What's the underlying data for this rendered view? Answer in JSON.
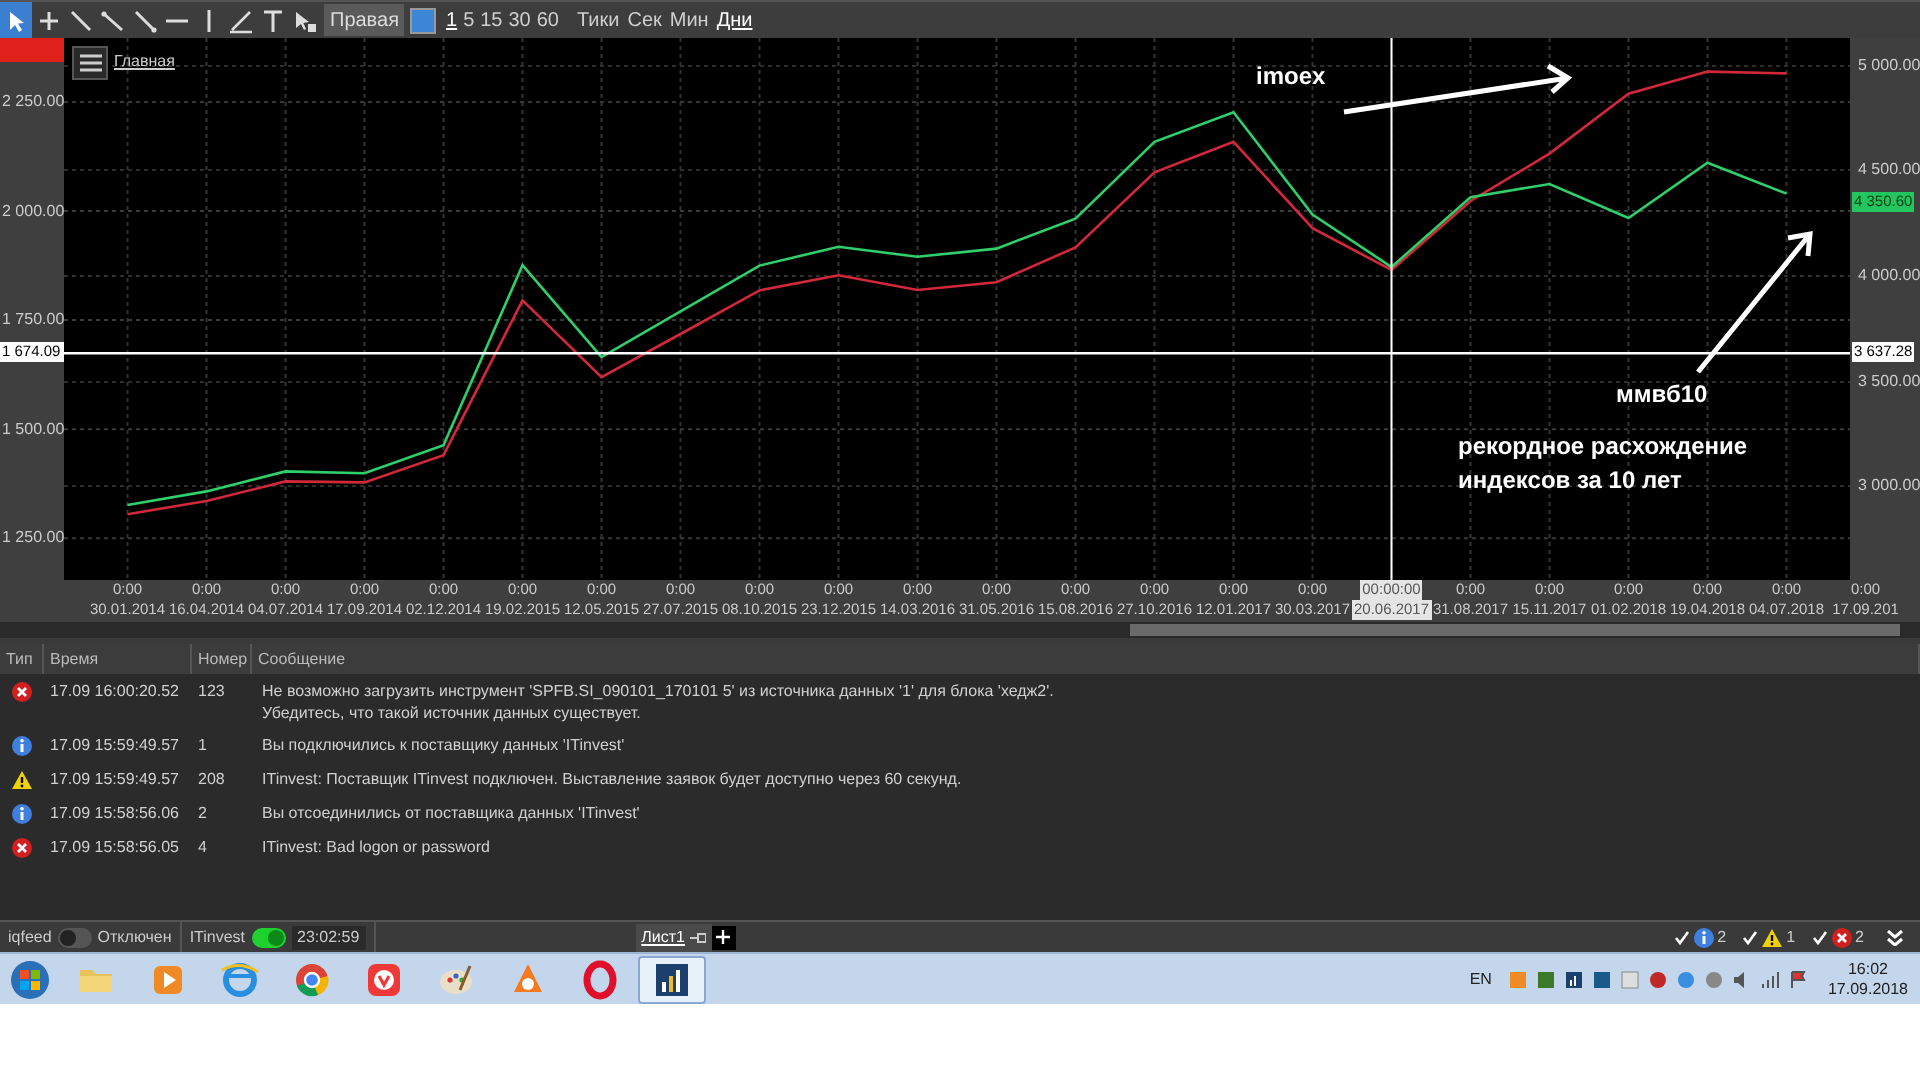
{
  "toolbar": {
    "tools": [
      {
        "kind": "pointer",
        "selected": true
      },
      {
        "kind": "crosshair",
        "selected": false
      },
      {
        "kind": "line",
        "selected": false
      },
      {
        "kind": "ray",
        "selected": false
      },
      {
        "kind": "segment",
        "selected": false
      },
      {
        "kind": "hline",
        "selected": false
      },
      {
        "kind": "vline",
        "selected": false
      },
      {
        "kind": "channel",
        "selected": false
      },
      {
        "kind": "text",
        "selected": false
      },
      {
        "kind": "cursor",
        "selected": false
      }
    ],
    "axis_dropdown": "Правая",
    "intervals": [
      {
        "label": "1",
        "selected": true
      },
      {
        "label": "5",
        "selected": false
      },
      {
        "label": "15",
        "selected": false
      },
      {
        "label": "30",
        "selected": false
      },
      {
        "label": "60",
        "selected": false
      }
    ],
    "units": [
      {
        "label": "Тики",
        "selected": false
      },
      {
        "label": "Сек",
        "selected": false
      },
      {
        "label": "Мин",
        "selected": false
      },
      {
        "label": "Дни",
        "selected": true
      }
    ]
  },
  "chart": {
    "panel_label": "Главная",
    "left_axis": {
      "current": "1 674.09"
    },
    "right_axis": {
      "ticks": [
        "5 000.00",
        "4 500.00",
        "4 000.00",
        "3 500.00",
        "3 000.00"
      ],
      "last": "4 350.60",
      "current": "3 637.28"
    },
    "time_axis": [
      {
        "time": "0:00",
        "selected": false
      },
      {
        "time": "0:00",
        "selected": false
      },
      {
        "time": "0:00",
        "selected": false
      },
      {
        "time": "0:00",
        "selected": false
      },
      {
        "time": "0:00",
        "selected": false
      },
      {
        "time": "0:00",
        "selected": false
      },
      {
        "time": "0:00",
        "selected": false
      },
      {
        "time": "0:00",
        "selected": false
      },
      {
        "time": "0:00",
        "selected": false
      },
      {
        "time": "0:00",
        "selected": false
      },
      {
        "time": "0:00",
        "selected": false
      },
      {
        "time": "0:00",
        "selected": false
      },
      {
        "time": "0:00",
        "selected": false
      },
      {
        "time": "0:00",
        "selected": false
      },
      {
        "time": "0:00",
        "selected": false
      },
      {
        "time": "0:00",
        "selected": false
      },
      {
        "time": "00:00:00",
        "selected": true
      },
      {
        "time": "0:00",
        "selected": false
      },
      {
        "time": "0:00",
        "selected": false
      },
      {
        "time": "0:00",
        "selected": false
      },
      {
        "time": "0:00",
        "selected": false
      },
      {
        "time": "0:00",
        "selected": false
      },
      {
        "time": "0:00",
        "selected": false
      }
    ],
    "chart_data": {
      "type": "line",
      "categories": [
        "30.01.2014",
        "16.04.2014",
        "04.07.2014",
        "17.09.2014",
        "02.12.2014",
        "19.02.2015",
        "12.05.2015",
        "27.07.2015",
        "08.10.2015",
        "23.12.2015",
        "14.03.2016",
        "31.05.2016",
        "15.08.2016",
        "27.10.2016",
        "12.01.2017",
        "30.03.2017",
        "20.06.2017",
        "31.08.2017",
        "15.11.2017",
        "01.02.2018",
        "19.04.2018",
        "04.07.2018",
        "17.09.201"
      ],
      "ylim": [
        1154,
        2397
      ],
      "grid": true,
      "ref_lines": [
        {
          "axis": "x",
          "value": "20.06.2017"
        },
        {
          "axis": "y",
          "value": 1674.09
        }
      ],
      "yticks": [
        {
          "value": 2250,
          "label": "2 250.00"
        },
        {
          "value": 2000,
          "label": "2 000.00"
        },
        {
          "value": 1750,
          "label": "1 750.00"
        },
        {
          "value": 1500,
          "label": "1 500.00"
        },
        {
          "value": 1250,
          "label": "1 250.00"
        }
      ],
      "series": [
        {
          "color": "#d2283a",
          "values": [
            1305,
            1335,
            1380,
            1378,
            1440,
            1795,
            1619,
            1718,
            1818,
            1853,
            1819,
            1837,
            1917,
            2089,
            2159,
            1961,
            1865,
            2023,
            2132,
            2269,
            2320,
            2316,
            null
          ]
        },
        {
          "color": "#2fcf6a",
          "values": [
            1326,
            1357,
            1403,
            1399,
            1463,
            1876,
            1665,
            1770,
            1875,
            1918,
            1895,
            1914,
            1983,
            2159,
            2227,
            1992,
            1872,
            2032,
            2062,
            1984,
            2111,
            2040,
            null
          ]
        }
      ]
    },
    "annotations": [
      {
        "kind": "label-arrow",
        "text": "imoex"
      },
      {
        "kind": "label-arrow",
        "text": "ммвб10"
      },
      {
        "kind": "note",
        "text": "рекордное расхождение индексов за 10 лет"
      }
    ]
  },
  "log": {
    "columns": [
      "Тип",
      "Время",
      "Номер",
      "Сообщение"
    ],
    "rows": [
      {
        "kind": "error",
        "time": "17.09 16:00:20.52",
        "number": "123",
        "message": [
          "Не возможно загрузить инструмент 'SPFB.SI_090101_170101 5' из источника данных '1' для блока 'хедж2'.",
          "Убедитесь, что такой источник данных существует."
        ]
      },
      {
        "kind": "info",
        "time": "17.09 15:59:49.57",
        "number": "1",
        "message": [
          "Вы подключились к поставщику данных 'ITinvest'"
        ]
      },
      {
        "kind": "warning",
        "time": "17.09 15:59:49.57",
        "number": "208",
        "message": [
          "ITinvest: Поставщик ITinvest подключен. Выставление заявок будет доступно через 60 секунд."
        ]
      },
      {
        "kind": "info",
        "time": "17.09 15:58:56.06",
        "number": "2",
        "message": [
          "Вы отсоединились от поставщика данных 'ITinvest'"
        ]
      },
      {
        "kind": "error",
        "time": "17.09 15:58:56.05",
        "number": "4",
        "message": [
          "ITinvest: Bad logon or password"
        ]
      }
    ]
  },
  "status_bar": {
    "connections": [
      {
        "name": "iqfeed",
        "on": false,
        "status": "Отключен"
      },
      {
        "name": "ITinvest",
        "on": true,
        "status": "23:02:59"
      }
    ],
    "sheets": [
      {
        "label": "Лист1",
        "selected": true
      }
    ],
    "filters": [
      {
        "kind": "info",
        "checked": true,
        "count": "2"
      },
      {
        "kind": "warning",
        "checked": true,
        "count": "1"
      },
      {
        "kind": "error",
        "checked": true,
        "count": "2"
      }
    ]
  },
  "taskbar": {
    "apps": [
      {
        "kind": "folder",
        "selected": false
      },
      {
        "kind": "player",
        "selected": false
      },
      {
        "kind": "ie",
        "selected": false
      },
      {
        "kind": "chrome",
        "selected": false
      },
      {
        "kind": "vivaldi",
        "selected": false
      },
      {
        "kind": "paint",
        "selected": false
      },
      {
        "kind": "avast",
        "selected": false
      },
      {
        "kind": "opera",
        "selected": false
      },
      {
        "kind": "chart",
        "selected": true
      }
    ],
    "language": "EN",
    "time": "16:02",
    "date": "17.09.2018"
  }
}
